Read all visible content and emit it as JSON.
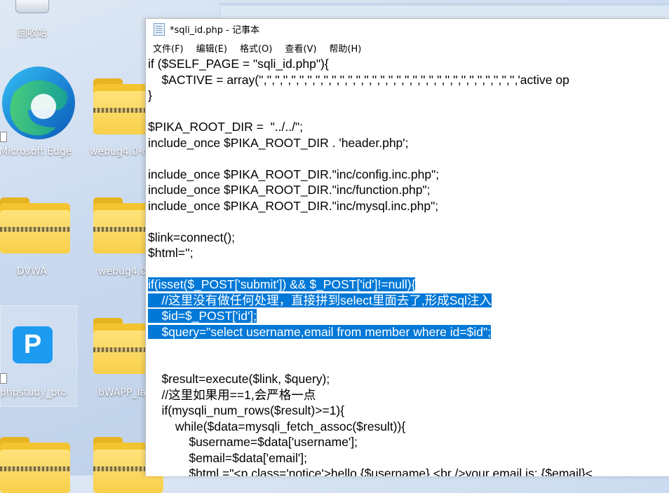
{
  "desktop": {
    "recycle_bin_label": "回收站",
    "icons": [
      {
        "label": "Microsoft Edge"
      },
      {
        "label": "webug4.0-n"
      },
      {
        "label": "DVWA"
      },
      {
        "label": "webug4.0"
      },
      {
        "label": "phpstudy_pro"
      },
      {
        "label": "bWAPP_la"
      }
    ],
    "phpstudy_glyph": "P"
  },
  "notepad": {
    "title": "*sqli_id.php - 记事本",
    "menu": [
      "文件(F)",
      "编辑(E)",
      "格式(O)",
      "查看(V)",
      "帮助(H)"
    ],
    "lines": [
      "if ($SELF_PAGE = \"sqli_id.php\"){",
      "    $ACTIVE = array('','','','','','','','','','','','','','','','','','','','','','','','','','','','','','','','','active op",
      "}",
      "",
      "$PIKA_ROOT_DIR =  \"../../\";",
      "include_once $PIKA_ROOT_DIR . 'header.php';",
      "",
      "include_once $PIKA_ROOT_DIR.\"inc/config.inc.php\";",
      "include_once $PIKA_ROOT_DIR.\"inc/function.php\";",
      "include_once $PIKA_ROOT_DIR.\"inc/mysql.inc.php\";",
      "",
      "$link=connect();",
      "$html='';",
      "",
      "if(isset($_POST['submit']) && $_POST['id']!=null){",
      "    //这里没有做任何处理，直接拼到select里面去了,形成Sql注入",
      "    $id=$_POST['id'];",
      "    $query=\"select username,email from member where id=$id\";",
      "",
      "",
      "    $result=execute($link, $query);",
      "    //这里如果用==1,会严格一点",
      "    if(mysqli_num_rows($result)>=1){",
      "        while($data=mysqli_fetch_assoc($result)){",
      "            $username=$data['username'];",
      "            $email=$data['email'];",
      "            $html.=\"<p class='notice'>hello,{$username} <br />your email is: {$email}<"
    ],
    "selected_lines": [
      14,
      15,
      16,
      17
    ],
    "colors": {
      "selection": "#0078d7",
      "selection_text": "#ffffff"
    }
  }
}
